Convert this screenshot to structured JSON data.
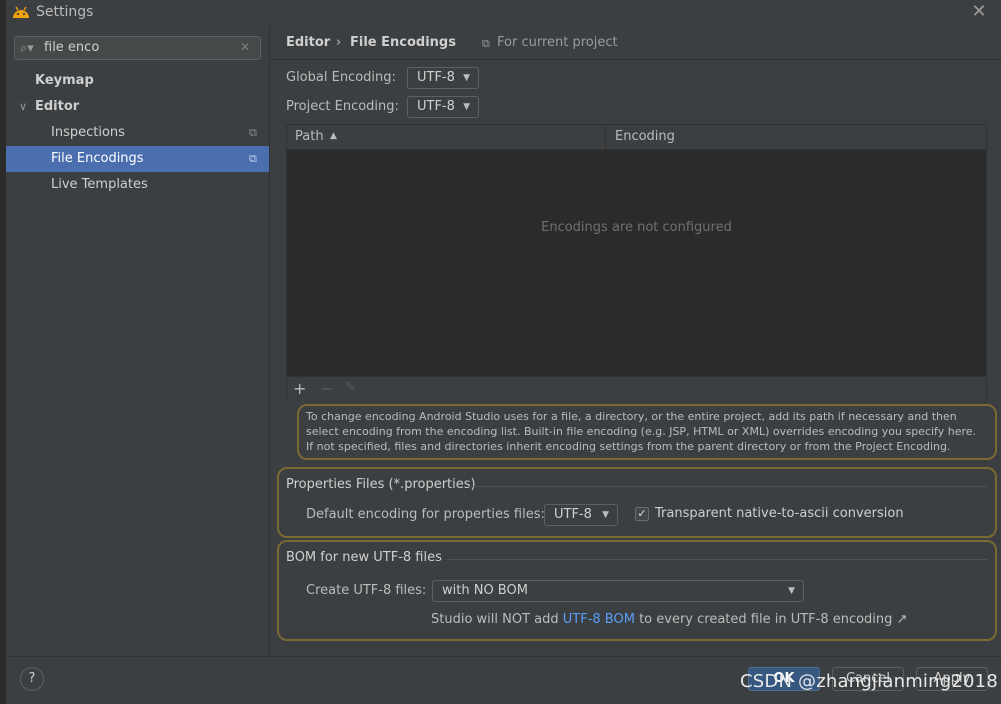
{
  "window": {
    "title": "Settings",
    "close_glyph": "✕",
    "app_icon": "android-icon"
  },
  "search": {
    "value": "file enco",
    "clear_glyph": "✕",
    "icon_glyph": "⌕▾"
  },
  "sidebar": {
    "items": [
      {
        "label": "Keymap"
      },
      {
        "label": "Editor",
        "expander": "∨"
      },
      {
        "label": "Inspections"
      },
      {
        "label": "File Encodings",
        "selected": true
      },
      {
        "label": "Live Templates"
      }
    ],
    "copy_glyph": "⧉"
  },
  "header": {
    "crumb_parent": "Editor",
    "crumb_sep": "›",
    "crumb_current": "File Encodings",
    "scope_icon": "⧉",
    "scope": "For current project"
  },
  "encoding": {
    "global_label": "Global Encoding:",
    "global_value": "UTF-8",
    "project_label": "Project Encoding:",
    "project_value": "UTF-8",
    "dropdown_arrow": "▼"
  },
  "table": {
    "col_path": "Path",
    "sort_glyph": "▲",
    "col_encoding": "Encoding",
    "empty_text": "Encodings are not configured",
    "add_glyph": "+",
    "remove_glyph": "−",
    "edit_glyph": "✎"
  },
  "info": {
    "text": "To change encoding Android Studio uses for a file, a directory, or the entire project, add its path if necessary and then select encoding from the encoding list. Built-in file encoding (e.g. JSP, HTML or XML) overrides encoding you specify here. If not specified, files and directories inherit encoding settings from the parent directory or from the Project Encoding."
  },
  "properties": {
    "title": "Properties Files (*.properties)",
    "default_label": "Default encoding for properties files:",
    "default_value": "UTF-8",
    "checkbox_checked": true,
    "checkbox_glyph": "✓",
    "checkbox_label": "Transparent native-to-ascii conversion"
  },
  "bom": {
    "title": "BOM for new UTF-8 files",
    "create_label": "Create UTF-8 files:",
    "create_value": "with NO BOM",
    "note_before": "Studio will NOT add ",
    "note_link": "UTF-8 BOM",
    "note_after": " to every created file in UTF-8 encoding ↗"
  },
  "buttons": {
    "help": "?",
    "ok": "OK",
    "cancel": "Cancel",
    "apply": "Apply"
  },
  "watermark": "CSDN @zhangjianming2018",
  "colors": {
    "selection": "#4b6eaf",
    "link": "#589df6",
    "highlight_border": "#7a6a34",
    "panel": "#3c3f41"
  }
}
